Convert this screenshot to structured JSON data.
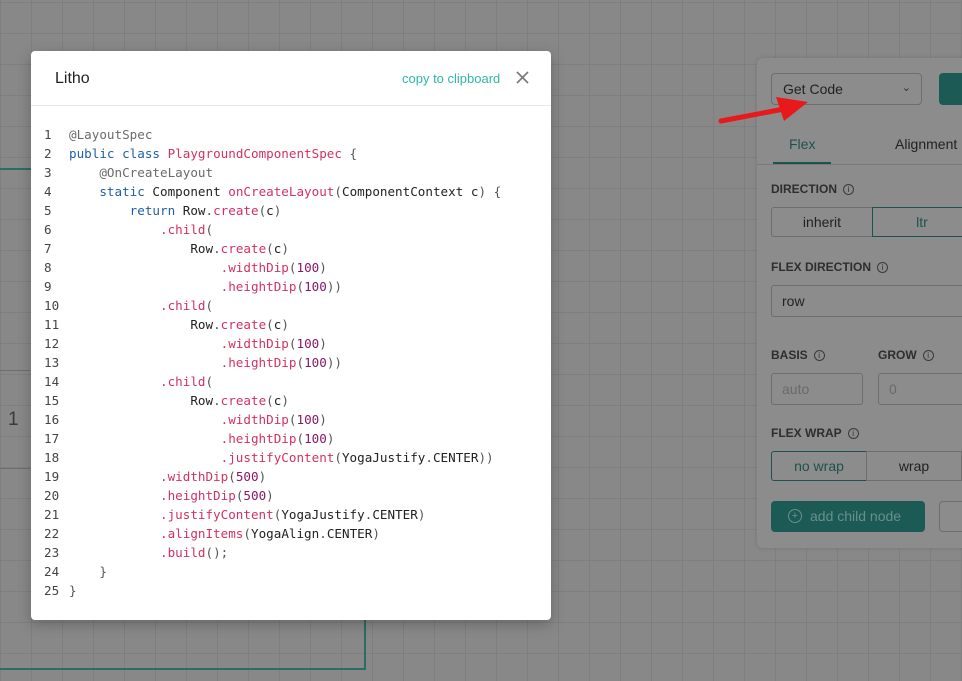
{
  "modal": {
    "title": "Litho",
    "copy_label": "copy to clipboard",
    "close_icon": "close-icon",
    "code_lines": [
      [
        [
          "@LayoutSpec",
          "anno"
        ]
      ],
      [
        [
          "public ",
          "kw"
        ],
        [
          "class ",
          "kw"
        ],
        [
          "PlaygroundComponentSpec",
          "fn"
        ],
        [
          " {",
          "punc"
        ]
      ],
      [
        [
          "    @OnCreateLayout",
          "anno"
        ]
      ],
      [
        [
          "    static ",
          "kw"
        ],
        [
          "Component ",
          "txt"
        ],
        [
          "onCreateLayout",
          "fn"
        ],
        [
          "(",
          "punc"
        ],
        [
          "ComponentContext c",
          "txt"
        ],
        [
          ") {",
          "punc"
        ]
      ],
      [
        [
          "        return ",
          "kw"
        ],
        [
          "Row",
          "txt"
        ],
        [
          ".",
          "punc"
        ],
        [
          "create",
          "fn"
        ],
        [
          "(",
          "punc"
        ],
        [
          "c",
          "txt"
        ],
        [
          ")",
          "punc"
        ]
      ],
      [
        [
          "            .child",
          "fn"
        ],
        [
          "(",
          "punc"
        ]
      ],
      [
        [
          "                Row",
          "txt"
        ],
        [
          ".",
          "punc"
        ],
        [
          "create",
          "fn"
        ],
        [
          "(",
          "punc"
        ],
        [
          "c",
          "txt"
        ],
        [
          ")",
          "punc"
        ]
      ],
      [
        [
          "                    .widthDip",
          "fn"
        ],
        [
          "(",
          "punc"
        ],
        [
          "100",
          "num"
        ],
        [
          ")",
          "punc"
        ]
      ],
      [
        [
          "                    .heightDip",
          "fn"
        ],
        [
          "(",
          "punc"
        ],
        [
          "100",
          "num"
        ],
        [
          "))",
          "punc"
        ]
      ],
      [
        [
          "            .child",
          "fn"
        ],
        [
          "(",
          "punc"
        ]
      ],
      [
        [
          "                Row",
          "txt"
        ],
        [
          ".",
          "punc"
        ],
        [
          "create",
          "fn"
        ],
        [
          "(",
          "punc"
        ],
        [
          "c",
          "txt"
        ],
        [
          ")",
          "punc"
        ]
      ],
      [
        [
          "                    .widthDip",
          "fn"
        ],
        [
          "(",
          "punc"
        ],
        [
          "100",
          "num"
        ],
        [
          ")",
          "punc"
        ]
      ],
      [
        [
          "                    .heightDip",
          "fn"
        ],
        [
          "(",
          "punc"
        ],
        [
          "100",
          "num"
        ],
        [
          "))",
          "punc"
        ]
      ],
      [
        [
          "            .child",
          "fn"
        ],
        [
          "(",
          "punc"
        ]
      ],
      [
        [
          "                Row",
          "txt"
        ],
        [
          ".",
          "punc"
        ],
        [
          "create",
          "fn"
        ],
        [
          "(",
          "punc"
        ],
        [
          "c",
          "txt"
        ],
        [
          ")",
          "punc"
        ]
      ],
      [
        [
          "                    .widthDip",
          "fn"
        ],
        [
          "(",
          "punc"
        ],
        [
          "100",
          "num"
        ],
        [
          ")",
          "punc"
        ]
      ],
      [
        [
          "                    .heightDip",
          "fn"
        ],
        [
          "(",
          "punc"
        ],
        [
          "100",
          "num"
        ],
        [
          ")",
          "punc"
        ]
      ],
      [
        [
          "                    .justifyContent",
          "fn"
        ],
        [
          "(",
          "punc"
        ],
        [
          "YogaJustify",
          "txt"
        ],
        [
          ".",
          "punc"
        ],
        [
          "CENTER",
          "txt"
        ],
        [
          "))",
          "punc"
        ]
      ],
      [
        [
          "            .widthDip",
          "fn"
        ],
        [
          "(",
          "punc"
        ],
        [
          "500",
          "num"
        ],
        [
          ")",
          "punc"
        ]
      ],
      [
        [
          "            .heightDip",
          "fn"
        ],
        [
          "(",
          "punc"
        ],
        [
          "500",
          "num"
        ],
        [
          ")",
          "punc"
        ]
      ],
      [
        [
          "            .justifyContent",
          "fn"
        ],
        [
          "(",
          "punc"
        ],
        [
          "YogaJustify",
          "txt"
        ],
        [
          ".",
          "punc"
        ],
        [
          "CENTER",
          "txt"
        ],
        [
          ")",
          "punc"
        ]
      ],
      [
        [
          "            .alignItems",
          "fn"
        ],
        [
          "(",
          "punc"
        ],
        [
          "YogaAlign",
          "txt"
        ],
        [
          ".",
          "punc"
        ],
        [
          "CENTER",
          "txt"
        ],
        [
          ")",
          "punc"
        ]
      ],
      [
        [
          "            .build",
          "fn"
        ],
        [
          "();",
          "punc"
        ]
      ],
      [
        [
          "    }",
          "punc"
        ]
      ],
      [
        [
          "}",
          "punc"
        ]
      ]
    ]
  },
  "canvas": {
    "label": "1"
  },
  "panel": {
    "get_code_select": "Get Code",
    "tabs": [
      "Flex",
      "Alignment"
    ],
    "direction": {
      "label": "DIRECTION",
      "options": [
        "inherit",
        "ltr"
      ],
      "selected": "ltr"
    },
    "flex_direction": {
      "label": "FLEX DIRECTION",
      "value": "row"
    },
    "basis": {
      "label": "BASIS",
      "placeholder": "auto"
    },
    "grow": {
      "label": "GROW",
      "placeholder": "0"
    },
    "flex_wrap": {
      "label": "FLEX WRAP",
      "options": [
        "no wrap",
        "wrap"
      ],
      "selected": "no wrap"
    },
    "add_child_label": "add child node"
  },
  "colors": {
    "accent": "#2fb8a6",
    "keyword": "#1f5fa5",
    "function": "#d23262",
    "number": "#8a1766",
    "annotation": "#6a6a6a",
    "arrow": "#e8191b"
  }
}
